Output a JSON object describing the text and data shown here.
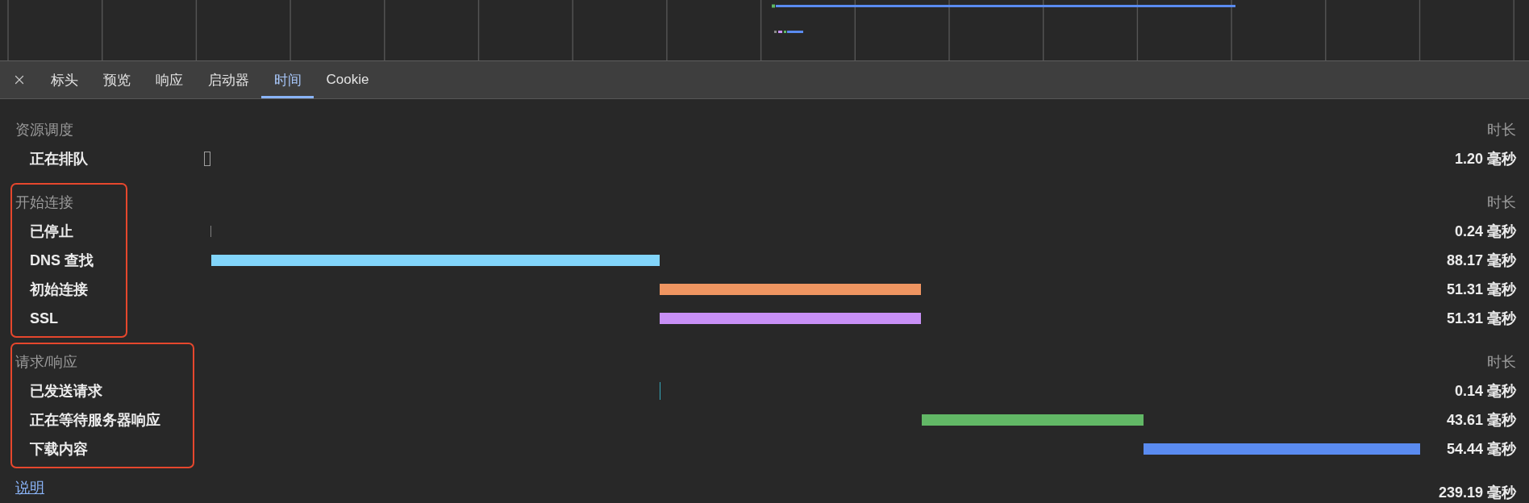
{
  "tabs": [
    {
      "label": "标头",
      "selected": false
    },
    {
      "label": "预览",
      "selected": false
    },
    {
      "label": "响应",
      "selected": false
    },
    {
      "label": "启动器",
      "selected": false
    },
    {
      "label": "时间",
      "selected": true
    },
    {
      "label": "Cookie",
      "selected": false
    }
  ],
  "timing_sections": [
    {
      "title": "资源调度",
      "duration_header": "时长",
      "highlighted": false,
      "rows": [
        {
          "label": "正在排队",
          "kind": "queue",
          "color": "#a0a0a0",
          "duration": "1.20 毫秒"
        }
      ]
    },
    {
      "title": "开始连接",
      "duration_header": "时长",
      "highlighted": true,
      "rows": [
        {
          "label": "已停止",
          "kind": "stall",
          "color": "#808080",
          "duration": "0.24 毫秒"
        },
        {
          "label": "DNS 查找",
          "kind": "bar",
          "color": "#82d5fa",
          "duration": "88.17 毫秒"
        },
        {
          "label": "初始连接",
          "kind": "bar",
          "color": "#ef9561",
          "duration": "51.31 毫秒"
        },
        {
          "label": "SSL",
          "kind": "overlap",
          "color": "#c890f6",
          "duration": "51.31 毫秒"
        }
      ]
    },
    {
      "title": "请求/响应",
      "duration_header": "时长",
      "highlighted": true,
      "rows": [
        {
          "label": "已发送请求",
          "kind": "sent",
          "color": "#34a7b9",
          "duration": "0.14 毫秒"
        },
        {
          "label": "正在等待服务器响应",
          "kind": "bar",
          "color": "#62b866",
          "duration": "43.61 毫秒"
        },
        {
          "label": "下载内容",
          "kind": "bar",
          "color": "#5a8bf0",
          "duration": "54.44 毫秒"
        }
      ]
    }
  ],
  "footer": {
    "link": "说明",
    "total": "239.19 毫秒"
  }
}
